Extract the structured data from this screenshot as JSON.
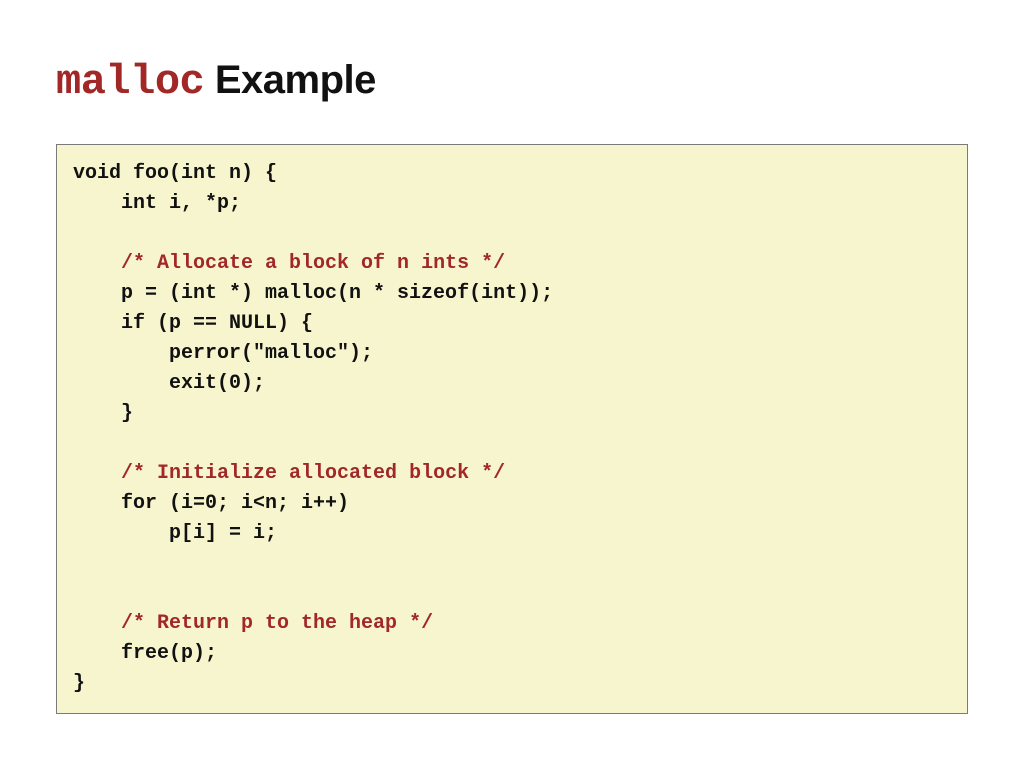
{
  "title": {
    "mono": "malloc",
    "rest": " Example"
  },
  "code": {
    "lines": [
      {
        "text": "void foo(int n) {",
        "comment": false
      },
      {
        "text": "    int i, *p;",
        "comment": false
      },
      {
        "text": "",
        "comment": false
      },
      {
        "text": "    /* Allocate a block of n ints */",
        "comment": true
      },
      {
        "text": "    p = (int *) malloc(n * sizeof(int));",
        "comment": false
      },
      {
        "text": "    if (p == NULL) {",
        "comment": false
      },
      {
        "text": "        perror(\"malloc\");",
        "comment": false
      },
      {
        "text": "        exit(0);",
        "comment": false
      },
      {
        "text": "    }",
        "comment": false
      },
      {
        "text": "",
        "comment": false
      },
      {
        "text": "    /* Initialize allocated block */",
        "comment": true
      },
      {
        "text": "    for (i=0; i<n; i++)",
        "comment": false
      },
      {
        "text": "        p[i] = i;",
        "comment": false
      },
      {
        "text": "",
        "comment": false
      },
      {
        "text": "",
        "comment": false
      },
      {
        "text": "    /* Return p to the heap */",
        "comment": true
      },
      {
        "text": "    free(p);",
        "comment": false
      },
      {
        "text": "}",
        "comment": false
      }
    ]
  }
}
